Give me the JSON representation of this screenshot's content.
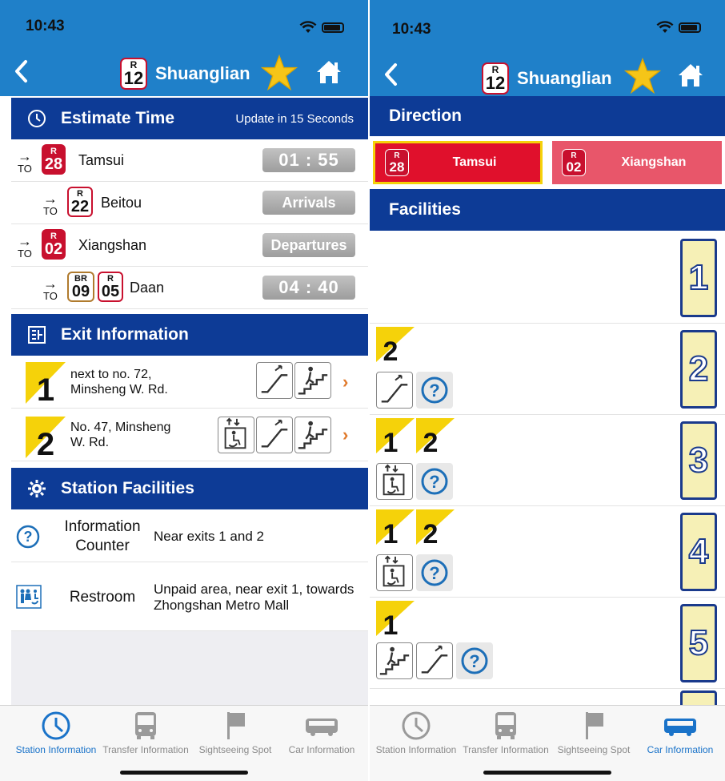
{
  "left": {
    "status_time": "10:43",
    "nav": {
      "line": "R",
      "number": "12",
      "title": "Shuanglian"
    },
    "estimate": {
      "heading": "Estimate Time",
      "update": "Update in 15 Seconds",
      "to_label": "TO",
      "rows": [
        {
          "line": "R",
          "number": "28",
          "dest": "Tamsui",
          "status": "01 : 55"
        },
        {
          "line": "R",
          "number": "22",
          "dest": "Beitou",
          "status": "Arrivals"
        },
        {
          "line": "R",
          "number": "02",
          "dest": "Xiangshan",
          "status": "Departures"
        },
        {
          "line": "BR",
          "number": "09",
          "line2": "R",
          "number2": "05",
          "dest": "Daan",
          "status": "04 : 40"
        }
      ]
    },
    "exits": {
      "heading": "Exit Information",
      "items": [
        {
          "number": "1",
          "text": "next to no. 72, Minsheng W. Rd.",
          "text_line1": "next to no. 72,",
          "text_line2": "Minsheng W. Rd."
        },
        {
          "number": "2",
          "text": "No. 47, Minsheng W. Rd.",
          "text_line1": "No. 47, Minsheng",
          "text_line2": "W. Rd."
        }
      ]
    },
    "facilities": {
      "heading": "Station Facilities",
      "items": [
        {
          "name_line1": "Information",
          "name_line2": "Counter",
          "desc_line1": "Near exits 1 and 2",
          "desc_line2": ""
        },
        {
          "name_line1": "Restroom",
          "name_line2": "",
          "desc_line1": "Unpaid area, near exit 1, towards",
          "desc_line2": "Zhongshan Metro Mall"
        }
      ]
    },
    "tabs": [
      "Station Information",
      "Transfer Information",
      "Sightseeing Spot",
      "Car Information"
    ],
    "active_tab": "Station Information"
  },
  "right": {
    "status_time": "10:43",
    "nav": {
      "line": "R",
      "number": "12",
      "title": "Shuanglian"
    },
    "direction": {
      "heading": "Direction",
      "options": [
        {
          "line": "R",
          "number": "28",
          "name": "Tamsui",
          "selected": true
        },
        {
          "line": "R",
          "number": "02",
          "name": "Xiangshan",
          "selected": false
        }
      ]
    },
    "facilities": {
      "heading": "Facilities",
      "cars": [
        {
          "car": "1",
          "exits": []
        },
        {
          "car": "2",
          "exits": [
            "2"
          ]
        },
        {
          "car": "3",
          "exits": [
            "1",
            "2"
          ]
        },
        {
          "car": "4",
          "exits": [
            "1",
            "2"
          ]
        },
        {
          "car": "5",
          "exits": [
            "1"
          ]
        }
      ]
    },
    "tabs": [
      "Station Information",
      "Transfer Information",
      "Sightseeing Spot",
      "Car Information"
    ],
    "active_tab": "Car Information"
  },
  "colors": {
    "header_blue": "#0d3b96",
    "bar_blue": "#1f80c9",
    "metro_red": "#c8102e",
    "exit_yellow": "#f5d20a",
    "active_tab": "#1a73c9",
    "direction_selected": "#e0102c",
    "direction_unselected": "#e8566a"
  }
}
